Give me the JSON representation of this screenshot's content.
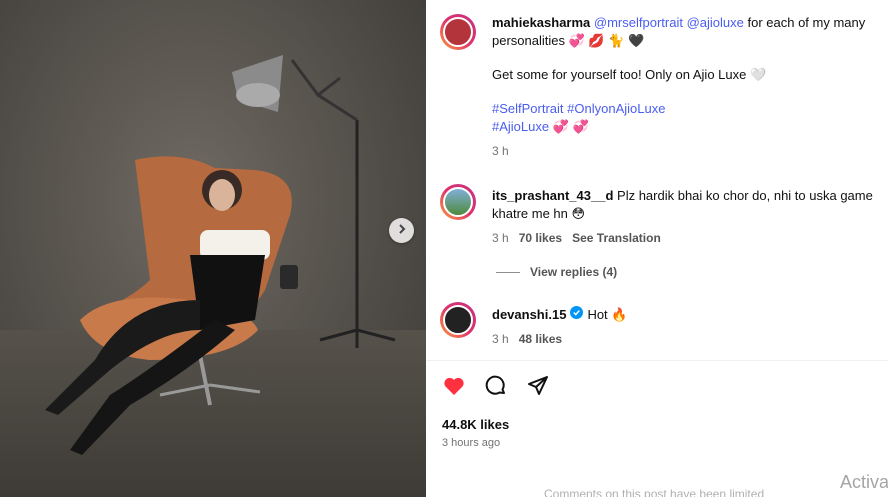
{
  "post": {
    "author": "mahiekasharma",
    "mention1": "@mrselfportrait",
    "mention2": "@ajioluxe",
    "caption_line1_rest": "for each of my many",
    "caption_line2": "personalities 💞 💋 🐈 🖤",
    "caption_para2": "Get some for yourself too! Only on Ajio Luxe 🤍",
    "hashtags_line1": "#SelfPortrait #OnlyonAjioLuxe",
    "hashtags_line2": "#AjioLuxe",
    "hashtags_emoji": "💞 💞",
    "time": "3 h"
  },
  "comments": [
    {
      "user": "its_prashant_43__d",
      "text": "Plz hardik bhai ko chor do, nhi to uska game khatre me hn 😳",
      "time": "3 h",
      "likes": "70 likes",
      "translate": "See Translation",
      "replies": "View replies (4)"
    },
    {
      "user": "devanshi.15",
      "text": "Hot 🔥",
      "time": "3 h",
      "likes": "48 likes"
    }
  ],
  "footer": {
    "likes": "44.8K likes",
    "ago": "3 hours ago",
    "watermark": "Activa",
    "limited": "Comments on this post have been limited"
  },
  "colors": {
    "like_red": "#ff3040",
    "link_blue": "#4a5df0",
    "verified_blue": "#0095f6"
  },
  "icons": [
    "chevron-right-icon",
    "heart-icon",
    "comment-icon",
    "share-icon",
    "verified-icon"
  ]
}
